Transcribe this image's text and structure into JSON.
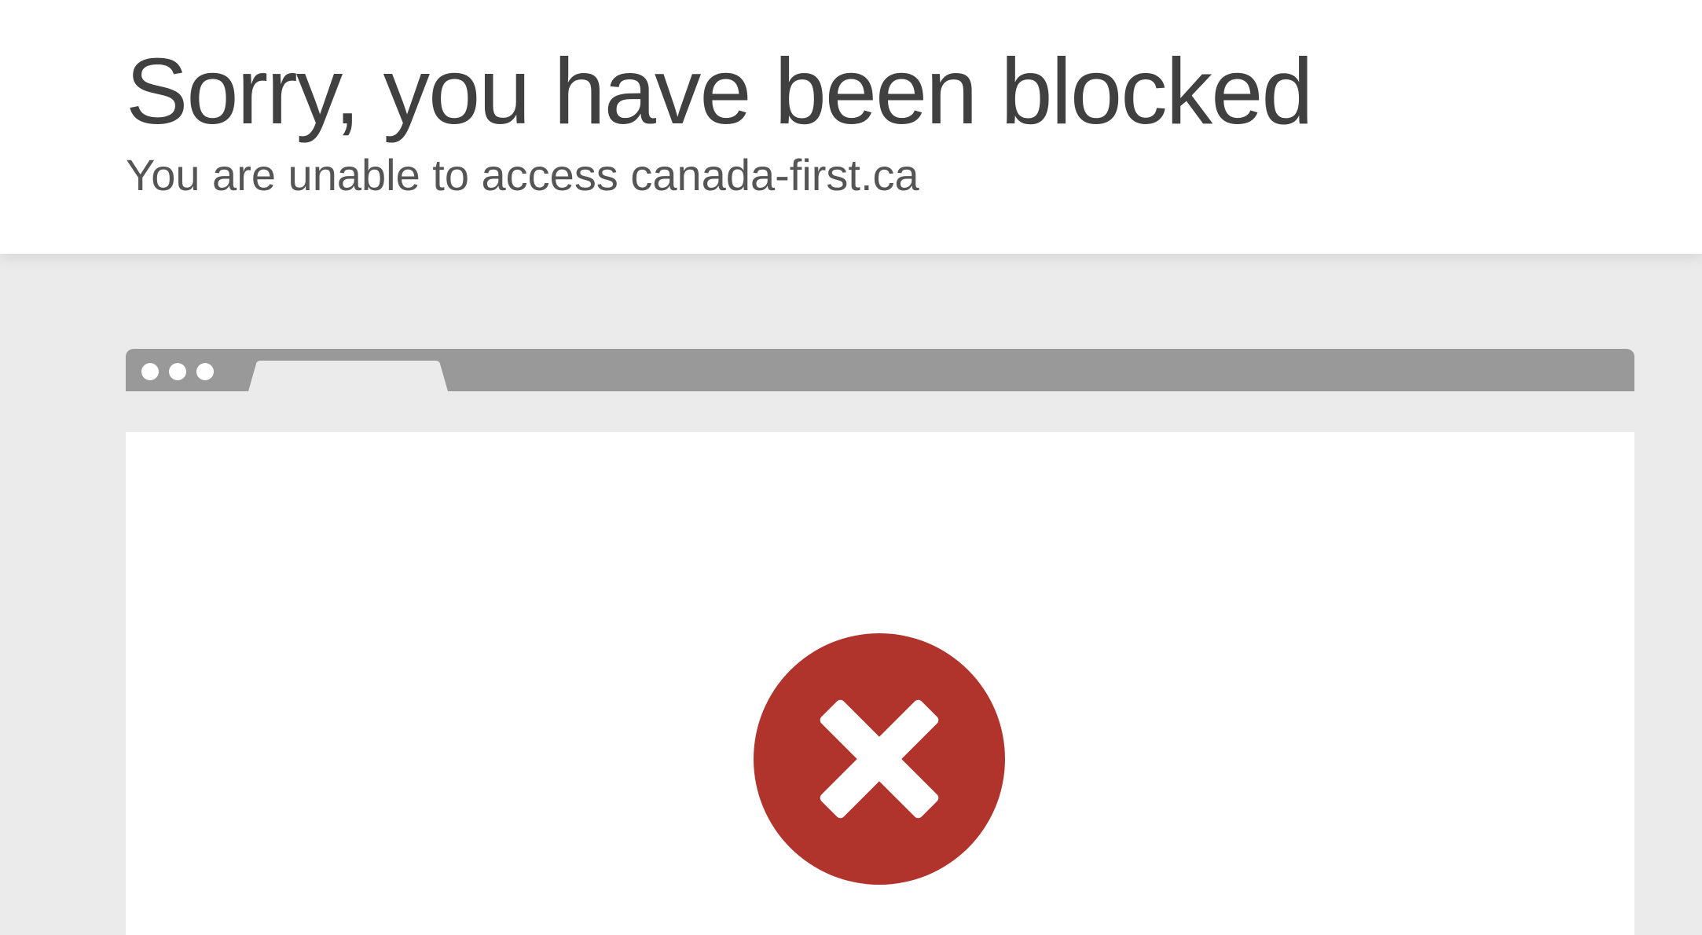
{
  "header": {
    "title": "Sorry, you have been blocked",
    "subtitle": "You are unable to access canada-first.ca"
  },
  "browser_illustration": {
    "dots": [
      "dot",
      "dot",
      "dot"
    ],
    "tab_label": ""
  },
  "icons": {
    "error": "error-x-circle-icon"
  },
  "colors": {
    "error_red": "#b0332c",
    "bar_gray": "#999999",
    "background": "#ebebeb"
  }
}
